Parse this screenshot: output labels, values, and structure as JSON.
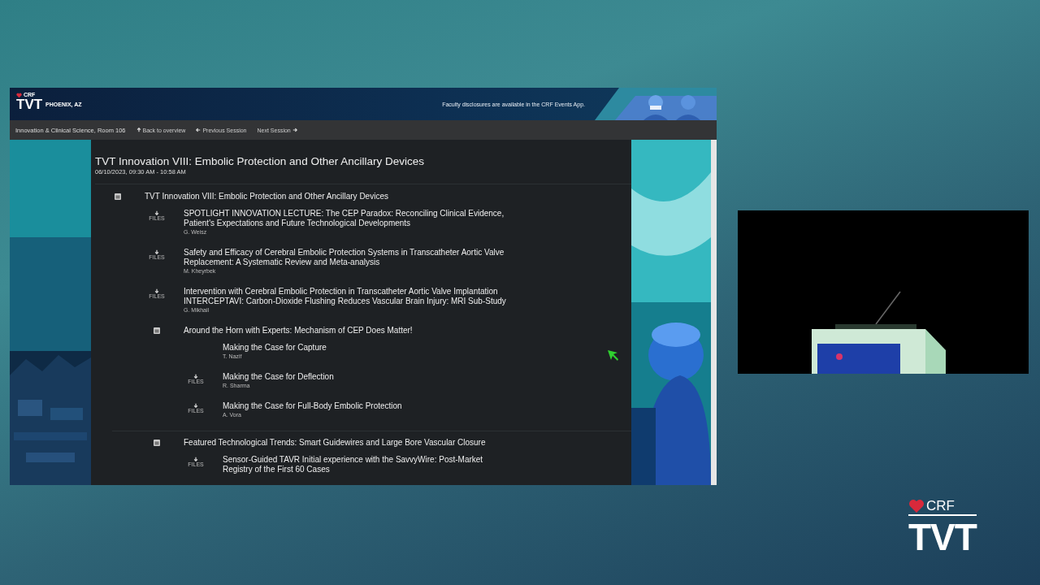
{
  "header": {
    "brand": "CRF",
    "title": "TVT",
    "city": "PHOENIX, AZ",
    "notice": "Faculty disclosures are available in the CRF Events App."
  },
  "nav": {
    "location": "Innovation & Clinical Science, Room 106",
    "links": [
      {
        "kind": "up",
        "label": "Back to overview"
      },
      {
        "kind": "prev",
        "label": "Previous Session"
      },
      {
        "kind": "next",
        "label": "Next Session"
      }
    ]
  },
  "session": {
    "title": "TVT Innovation VIII: Embolic Protection and Other Ancillary Devices",
    "time": "06/10/2023, 09:30 AM - 10:58 AM"
  },
  "agenda": [
    {
      "kind": "group",
      "title": "TVT Innovation VIII: Embolic Protection and Other Ancillary Devices",
      "children": [
        {
          "kind": "talk",
          "files": "FILES",
          "title": "SPOTLIGHT INNOVATION LECTURE: The CEP Paradox: Reconciling Clinical Evidence,\nPatient's Expectations and Future Technological Developments",
          "speaker": "G. Weisz"
        },
        {
          "kind": "talk",
          "files": "FILES",
          "title": "Safety and Efficacy of Cerebral Embolic Protection Systems in Transcatheter Aortic Valve\nReplacement: A Systematic Review and Meta-analysis",
          "speaker": "M. Kheyrbek"
        },
        {
          "kind": "talk",
          "files": "FILES",
          "title": "Intervention with Cerebral Embolic Protection in Transcatheter Aortic Valve Implantation\nINTERCEPTAVI: Carbon-Dioxide Flushing Reduces Vascular Brain Injury: MRI Sub-Study",
          "speaker": "G. Mikhail"
        },
        {
          "kind": "group",
          "title": "Around the Horn with Experts: Mechanism of CEP Does Matter!",
          "children": [
            {
              "kind": "talk",
              "title": "Making the Case for Capture",
              "speaker": "T. Nazif"
            },
            {
              "kind": "talk",
              "files": "FILES",
              "title": "Making the Case for Deflection",
              "speaker": "R. Sharma"
            },
            {
              "kind": "talk",
              "files": "FILES",
              "title": "Making the Case for Full-Body Embolic Protection",
              "speaker": "A. Vora"
            }
          ]
        },
        {
          "kind": "group",
          "title": "Featured Technological Trends: Smart Guidewires and Large Bore Vascular Closure",
          "children": [
            {
              "kind": "talk",
              "files": "FILES",
              "title": "Sensor-Guided TAVR Initial experience with the SavvyWire: Post-Market\nRegistry of the First 60 Cases"
            }
          ]
        }
      ]
    }
  ],
  "logo": {
    "brand": "CRF",
    "title": "TVT"
  }
}
